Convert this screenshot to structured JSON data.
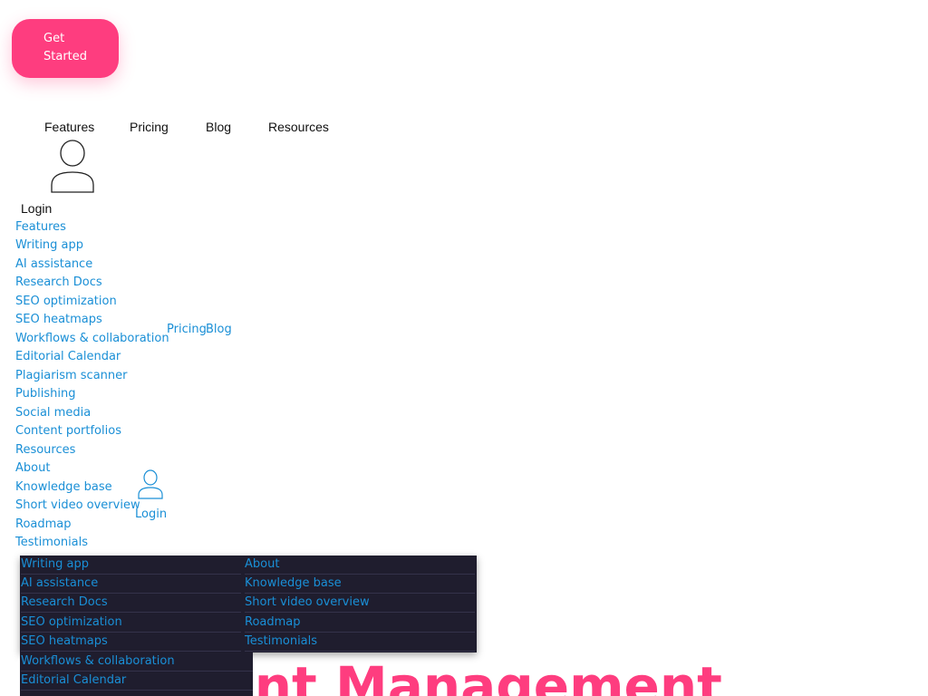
{
  "header": {
    "cta_label": "Get Started"
  },
  "top_nav": {
    "items": [
      "Features",
      "Pricing",
      "Blog",
      "Resources"
    ],
    "login_label": "Login"
  },
  "mobile_menu": {
    "items": [
      "Features",
      "Writing app",
      "AI assistance",
      "Research Docs",
      "SEO optimization",
      "SEO heatmaps",
      "Workflows & collaboration",
      "Editorial Calendar",
      "Plagiarism scanner",
      "Publishing",
      "Social media",
      "Content portfolios",
      "Resources",
      "About",
      "Knowledge base",
      "Short video overview",
      "Roadmap",
      "Testimonials"
    ],
    "pricing_label": "Pricing",
    "blog_label": "Blog",
    "login_label": "Login"
  },
  "dropdown": {
    "features_column": [
      "Writing app",
      "AI assistance",
      "Research Docs",
      "SEO optimization",
      "SEO heatmaps",
      "Workflows & collaboration",
      "Editorial Calendar"
    ],
    "resources_column": [
      "About",
      "Knowledge base",
      "Short video overview",
      "Roadmap",
      "Testimonials"
    ]
  },
  "hero": {
    "title": "Content Management"
  },
  "colors": {
    "accent": "#fe3d7f",
    "link": "#1a8fd6",
    "dropdown_bg": "#1f1d2e"
  },
  "icons": [
    "user-icon"
  ]
}
